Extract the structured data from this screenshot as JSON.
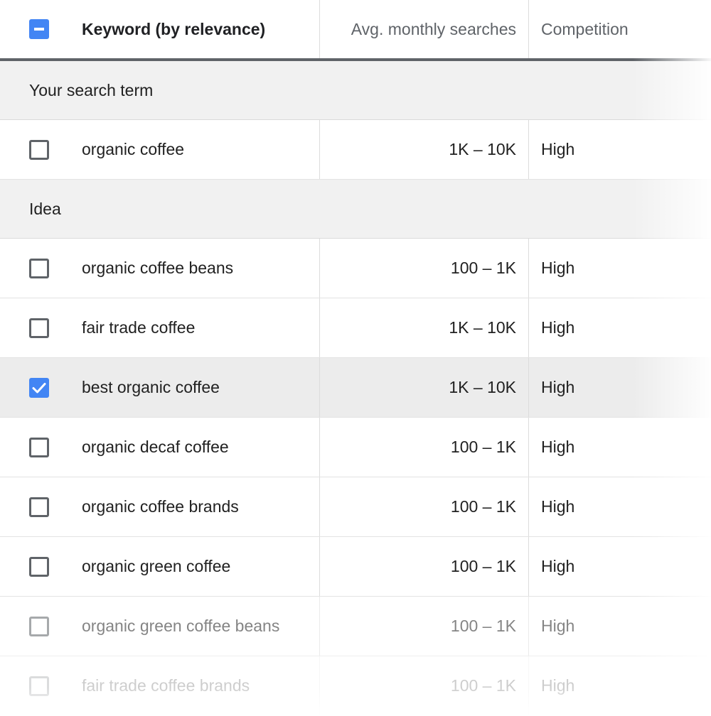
{
  "header": {
    "select_all_state": "indeterminate",
    "keyword_col": "Keyword (by relevance)",
    "avg_col": "Avg. monthly searches",
    "competition_col": "Competition"
  },
  "colors": {
    "accent": "#4285f4",
    "header_border": "#5f6368",
    "group_bg": "#f1f1f1",
    "selected_row_bg": "#ececec"
  },
  "groups": [
    {
      "label": "Your search term",
      "rows": [
        {
          "keyword": "organic coffee",
          "avg": "1K – 10K",
          "competition": "High",
          "checked": false
        }
      ]
    },
    {
      "label": "Idea",
      "rows": [
        {
          "keyword": "organic coffee beans",
          "avg": "100 – 1K",
          "competition": "High",
          "checked": false
        },
        {
          "keyword": "fair trade coffee",
          "avg": "1K – 10K",
          "competition": "High",
          "checked": false
        },
        {
          "keyword": "best organic coffee",
          "avg": "1K – 10K",
          "competition": "High",
          "checked": true
        },
        {
          "keyword": "organic decaf coffee",
          "avg": "100 – 1K",
          "competition": "High",
          "checked": false
        },
        {
          "keyword": "organic coffee brands",
          "avg": "100 – 1K",
          "competition": "High",
          "checked": false
        },
        {
          "keyword": "organic green coffee",
          "avg": "100 – 1K",
          "competition": "High",
          "checked": false
        },
        {
          "keyword": "organic green coffee beans",
          "avg": "100 – 1K",
          "competition": "High",
          "checked": false
        },
        {
          "keyword": "fair trade coffee brands",
          "avg": "100 – 1K",
          "competition": "High",
          "checked": false
        }
      ]
    }
  ]
}
